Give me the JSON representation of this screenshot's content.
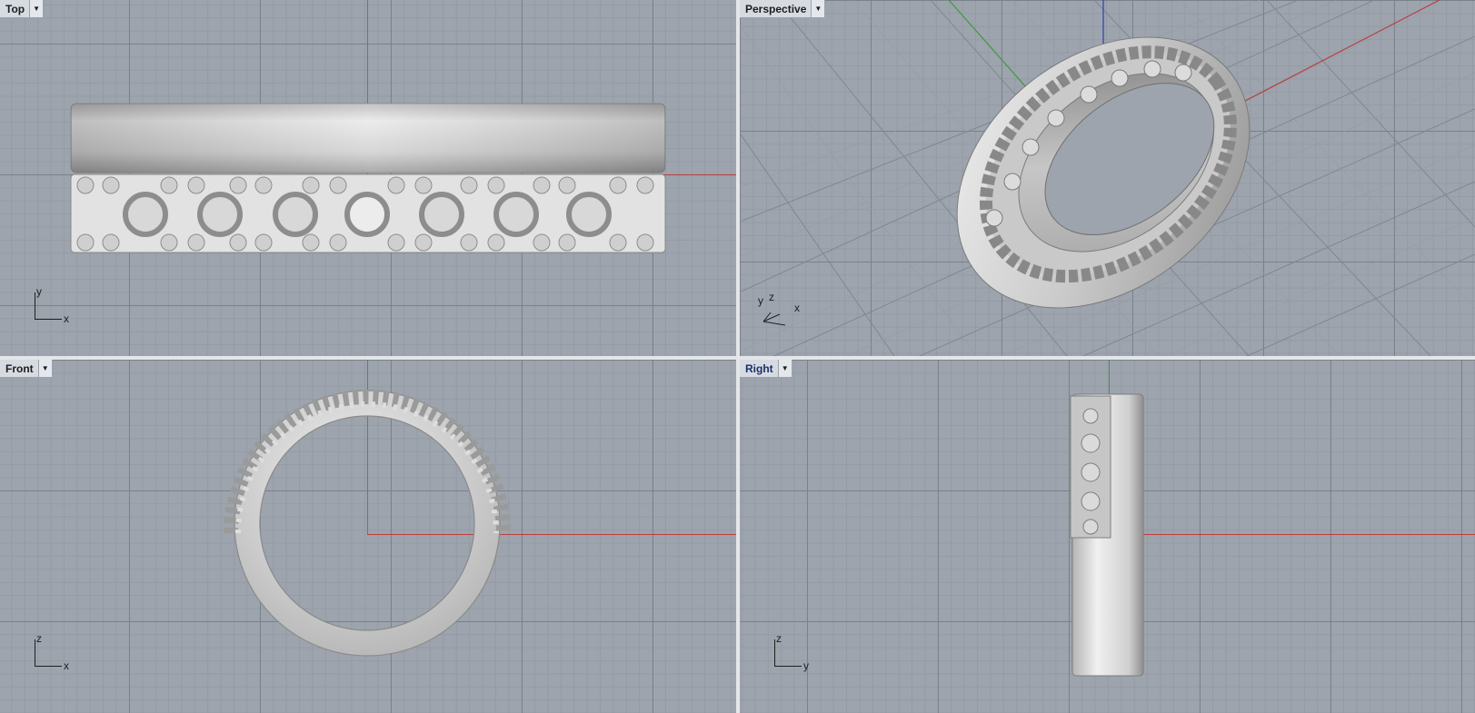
{
  "viewports": {
    "top": {
      "title": "Top",
      "axis_a": "y",
      "axis_b": "x"
    },
    "perspective": {
      "title": "Perspective",
      "axis_a": "y",
      "axis_b": "z",
      "axis_c": "x"
    },
    "front": {
      "title": "Front",
      "axis_a": "z",
      "axis_b": "x"
    },
    "right": {
      "title": "Right",
      "axis_a": "z",
      "axis_b": "y"
    }
  },
  "menu_icon": "chevron-down-icon",
  "colors": {
    "grid_bg": "#9da4ad",
    "x_axis": "#b83e3e",
    "y_axis": "#3e9a3e",
    "z_axis": "#2b3db8",
    "model": "#d9d9d9",
    "active_title": "#1b2f6a"
  }
}
